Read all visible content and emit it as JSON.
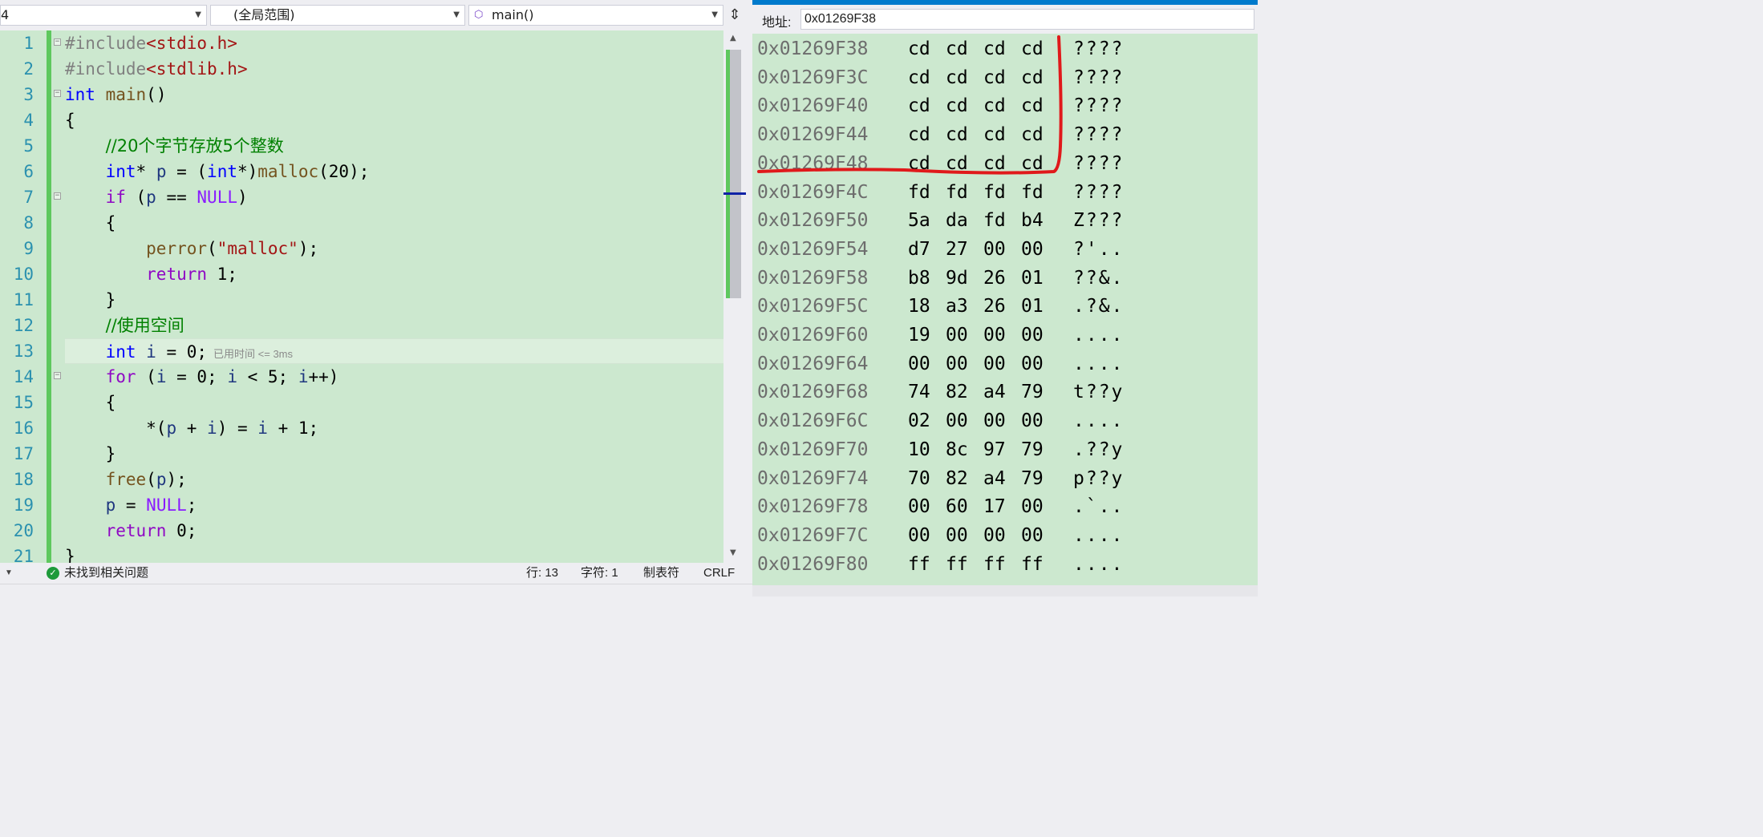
{
  "editor": {
    "nav": {
      "file_combo": "4",
      "scope_combo": "(全局范围)",
      "func_combo": "main()"
    },
    "line_numbers": [
      "1",
      "2",
      "3",
      "4",
      "5",
      "6",
      "7",
      "8",
      "9",
      "10",
      "11",
      "12",
      "13",
      "14",
      "15",
      "16",
      "17",
      "18",
      "19",
      "20",
      "21"
    ],
    "code": {
      "l1_pp": "#include",
      "l1_inc": "<stdio.h>",
      "l2_pp": "#include",
      "l2_inc": "<stdlib.h>",
      "l3_kw": "int",
      "l3_fn": "main",
      "l3_rest": "()",
      "l4": "{",
      "l5_comment": "//20个字节存放5个整数",
      "l6_kw": "int",
      "l6_a": "* ",
      "l6_var": "p",
      "l6_b": " = (",
      "l6_kw2": "int",
      "l6_c": "*)",
      "l6_fn": "malloc",
      "l6_d": "(20);",
      "l7_kw": "if",
      "l7_a": " (",
      "l7_var": "p",
      "l7_b": " == ",
      "l7_macro": "NULL",
      "l7_c": ")",
      "l8": "{",
      "l9_fn": "perror",
      "l9_a": "(",
      "l9_str": "\"malloc\"",
      "l9_b": ");",
      "l10_kw": "return",
      "l10_a": " 1;",
      "l11": "}",
      "l12_comment": "//使用空间",
      "l13_kw": "int",
      "l13_a": " ",
      "l13_var": "i",
      "l13_b": " = 0;",
      "l13_hint": "已用时间 <= 3ms",
      "l14_kw": "for",
      "l14_a": " (",
      "l14_v1": "i",
      "l14_b": " = 0; ",
      "l14_v2": "i",
      "l14_c": " < 5; ",
      "l14_v3": "i",
      "l14_d": "++)",
      "l15": "{",
      "l16_a": "*(",
      "l16_v1": "p",
      "l16_b": " + ",
      "l16_v2": "i",
      "l16_c": ") = ",
      "l16_v3": "i",
      "l16_d": " + 1;",
      "l17": "}",
      "l18_fn": "free",
      "l18_a": "(",
      "l18_var": "p",
      "l18_b": ");",
      "l19_var": "p",
      "l19_a": " = ",
      "l19_macro": "NULL",
      "l19_b": ";",
      "l20_kw": "return",
      "l20_a": " 0;",
      "l21": "}"
    },
    "status": {
      "issues": "未找到相关问题",
      "line": "行: 13",
      "char": "字符: 1",
      "tabs": "制表符",
      "line_ending": "CRLF"
    }
  },
  "memory": {
    "address_label": "地址:",
    "address_value": "0x01269F38",
    "highlight_color": "#e0191b",
    "rows": [
      {
        "addr": "0x01269F38",
        "b": [
          "cd",
          "cd",
          "cd",
          "cd"
        ],
        "ascii": "????"
      },
      {
        "addr": "0x01269F3C",
        "b": [
          "cd",
          "cd",
          "cd",
          "cd"
        ],
        "ascii": "????"
      },
      {
        "addr": "0x01269F40",
        "b": [
          "cd",
          "cd",
          "cd",
          "cd"
        ],
        "ascii": "????"
      },
      {
        "addr": "0x01269F44",
        "b": [
          "cd",
          "cd",
          "cd",
          "cd"
        ],
        "ascii": "????"
      },
      {
        "addr": "0x01269F48",
        "b": [
          "cd",
          "cd",
          "cd",
          "cd"
        ],
        "ascii": "????"
      },
      {
        "addr": "0x01269F4C",
        "b": [
          "fd",
          "fd",
          "fd",
          "fd"
        ],
        "ascii": "????"
      },
      {
        "addr": "0x01269F50",
        "b": [
          "5a",
          "da",
          "fd",
          "b4"
        ],
        "ascii": "Z???"
      },
      {
        "addr": "0x01269F54",
        "b": [
          "d7",
          "27",
          "00",
          "00"
        ],
        "ascii": "?'.."
      },
      {
        "addr": "0x01269F58",
        "b": [
          "b8",
          "9d",
          "26",
          "01"
        ],
        "ascii": "??&."
      },
      {
        "addr": "0x01269F5C",
        "b": [
          "18",
          "a3",
          "26",
          "01"
        ],
        "ascii": ".?&."
      },
      {
        "addr": "0x01269F60",
        "b": [
          "19",
          "00",
          "00",
          "00"
        ],
        "ascii": "...."
      },
      {
        "addr": "0x01269F64",
        "b": [
          "00",
          "00",
          "00",
          "00"
        ],
        "ascii": "...."
      },
      {
        "addr": "0x01269F68",
        "b": [
          "74",
          "82",
          "a4",
          "79"
        ],
        "ascii": "t??y"
      },
      {
        "addr": "0x01269F6C",
        "b": [
          "02",
          "00",
          "00",
          "00"
        ],
        "ascii": "...."
      },
      {
        "addr": "0x01269F70",
        "b": [
          "10",
          "8c",
          "97",
          "79"
        ],
        "ascii": ".??y"
      },
      {
        "addr": "0x01269F74",
        "b": [
          "70",
          "82",
          "a4",
          "79"
        ],
        "ascii": "p??y"
      },
      {
        "addr": "0x01269F78",
        "b": [
          "00",
          "60",
          "17",
          "00"
        ],
        "ascii": ".`.."
      },
      {
        "addr": "0x01269F7C",
        "b": [
          "00",
          "00",
          "00",
          "00"
        ],
        "ascii": "...."
      },
      {
        "addr": "0x01269F80",
        "b": [
          "ff",
          "ff",
          "ff",
          "ff"
        ],
        "ascii": "...."
      }
    ]
  }
}
